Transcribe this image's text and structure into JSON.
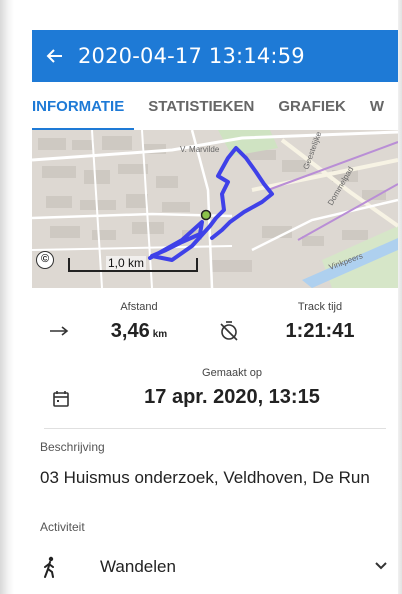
{
  "app_bar": {
    "back_icon": "arrow-left-icon",
    "title": "2020-04-17 13:14:59",
    "color": "#1e7ad6"
  },
  "tabs": [
    {
      "label": "INFORMATIE",
      "active": true
    },
    {
      "label": "STATISTIEKEN",
      "active": false
    },
    {
      "label": "GRAFIEK",
      "active": false
    },
    {
      "label": "W",
      "active": false
    }
  ],
  "map": {
    "street_labels": [
      "V. Marvilde",
      "Dommelpad",
      "Geestelijke",
      "Vinkpeers"
    ],
    "scale_label": "1,0 km",
    "copyright_icon": "copyright-icon",
    "track_color": "#3f41e8"
  },
  "stats": {
    "distance": {
      "label": "Afstand",
      "value": "3,46",
      "unit": "km",
      "icon": "arrow-right-icon"
    },
    "track_time": {
      "label": "Track tijd",
      "value": "1:21:41",
      "icon": "timer-off-icon"
    },
    "created": {
      "label": "Gemaakt op",
      "value": "17 apr. 2020, 13:15",
      "icon": "calendar-icon"
    }
  },
  "description": {
    "label": "Beschrijving",
    "value": "03 Huismus onderzoek, Veldhoven, De Run"
  },
  "activity": {
    "label": "Activiteit",
    "value": "Wandelen",
    "icon": "walking-icon",
    "dropdown_icon": "chevron-down-icon"
  }
}
